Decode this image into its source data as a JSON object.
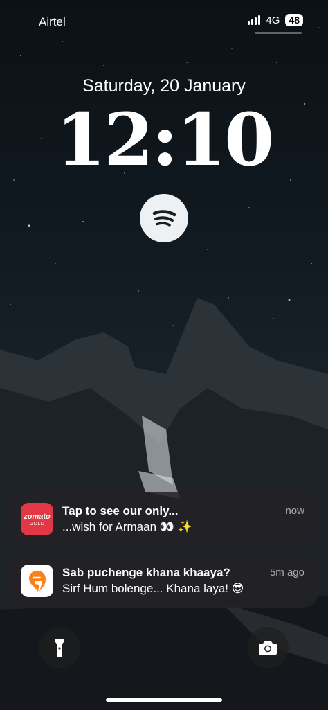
{
  "status_bar": {
    "carrier": "Airtel",
    "network": "4G",
    "battery": "48"
  },
  "lockscreen": {
    "date": "Saturday, 20 January",
    "time": "12:10"
  },
  "widget": {
    "icon": "spotify-icon"
  },
  "notifications": [
    {
      "app_icon": "zomato-gold-icon",
      "icon_text_1": "zomato",
      "icon_text_2": "GOLD",
      "title": "Tap to see our only...",
      "body": "...wish for Armaan 👀 ✨",
      "time": "now"
    },
    {
      "app_icon": "swiggy-icon",
      "title": "Sab puchenge khana khaaya?",
      "body": "Sirf Hum bolenge... Khana laya! 😎",
      "time": "5m ago"
    }
  ],
  "quick_actions": {
    "left_icon": "flashlight-icon",
    "right_icon": "camera-icon"
  },
  "colors": {
    "zomato_red": "#e23744",
    "swiggy_orange": "#fc8019",
    "spotify_bg": "#eef1f4"
  }
}
